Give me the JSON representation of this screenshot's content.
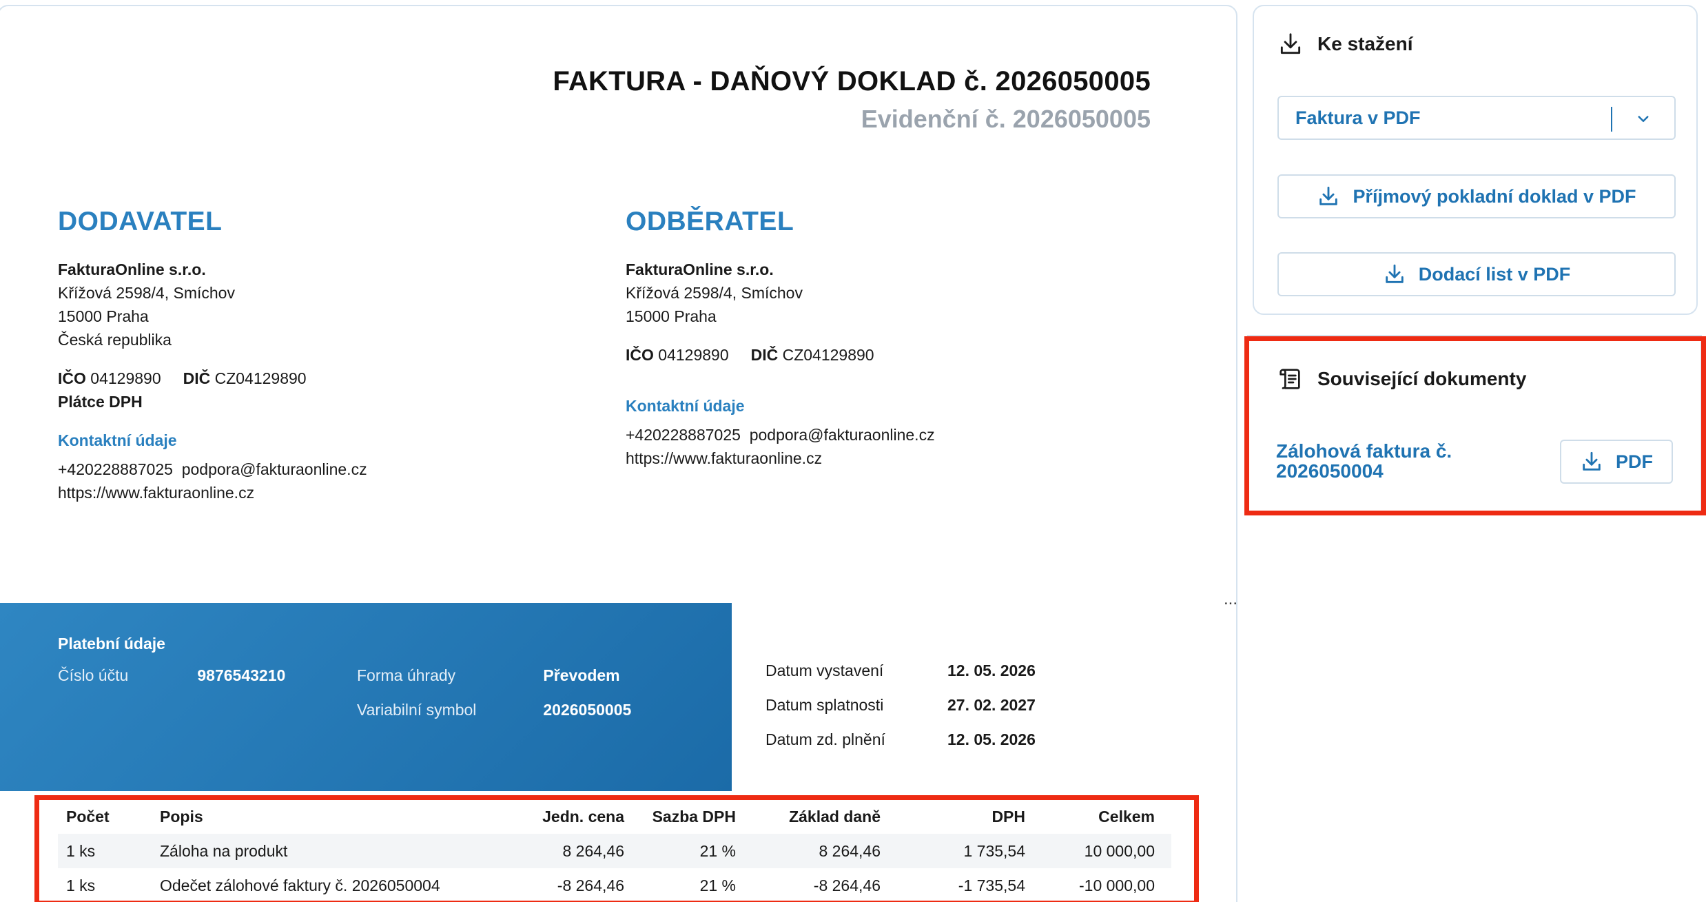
{
  "invoice": {
    "title": "FAKTURA - DAŇOVÝ DOKLAD č. 2026050005",
    "evidence": "Evidenční č. 2026050005"
  },
  "supplier": {
    "heading": "DODAVATEL",
    "name": "FakturaOnline s.r.o.",
    "street": "Křížová 2598/4, Smíchov",
    "city": "15000 Praha",
    "country": "Česká republika",
    "ico_label": "IČO",
    "ico": "04129890",
    "dic_label": "DIČ",
    "dic": "CZ04129890",
    "vat_payer": "Plátce DPH",
    "contact_heading": "Kontaktní údaje",
    "phone": "+420228887025",
    "email": "podpora@fakturaonline.cz",
    "web": "https://www.fakturaonline.cz"
  },
  "customer": {
    "heading": "ODBĚRATEL",
    "name": "FakturaOnline s.r.o.",
    "street": "Křížová 2598/4, Smíchov",
    "city": "15000 Praha",
    "ico_label": "IČO",
    "ico": "04129890",
    "dic_label": "DIČ",
    "dic": "CZ04129890",
    "contact_heading": "Kontaktní údaje",
    "phone": "+420228887025",
    "email": "podpora@fakturaonline.cz",
    "web": "https://www.fakturaonline.cz"
  },
  "ellipsis": "...",
  "payment": {
    "heading": "Platební údaje",
    "account_label": "Číslo účtu",
    "account": "9876543210",
    "method_label": "Forma úhrady",
    "method": "Převodem",
    "vs_label": "Variabilní symbol",
    "vs": "2026050005"
  },
  "dates": {
    "issued_label": "Datum vystavení",
    "issued": "12. 05. 2026",
    "due_label": "Datum splatnosti",
    "due": "27. 02. 2027",
    "taxable_label": "Datum zd. plnění",
    "taxable": "12. 05. 2026"
  },
  "items": {
    "headers": [
      "Počet",
      "Popis",
      "Jedn. cena",
      "Sazba DPH",
      "Základ daně",
      "DPH",
      "Celkem"
    ],
    "rows": [
      [
        "1 ks",
        "Záloha na produkt",
        "8 264,46",
        "21 %",
        "8 264,46",
        "1 735,54",
        "10 000,00"
      ],
      [
        "1 ks",
        "Odečet zálohové faktury č. 2026050004",
        "-8 264,46",
        "21 %",
        "-8 264,46",
        "-1 735,54",
        "-10 000,00"
      ]
    ]
  },
  "download_panel": {
    "heading": "Ke stažení",
    "icon": "download-icon",
    "select_value": "Faktura v PDF",
    "receipt_button": "Příjmový pokladní doklad v PDF",
    "delivery_button": "Dodací list v PDF"
  },
  "related": {
    "heading": "Související dokumenty",
    "icon": "document-icon",
    "link": "Zálohová faktura č. 2026050004",
    "pdf_button": "PDF"
  },
  "colors": {
    "accent": "#2a80bf",
    "link": "#1f73b2",
    "payband": "#2578b6",
    "highlight": "#ee2b13",
    "muted": "#9aa3ad"
  }
}
